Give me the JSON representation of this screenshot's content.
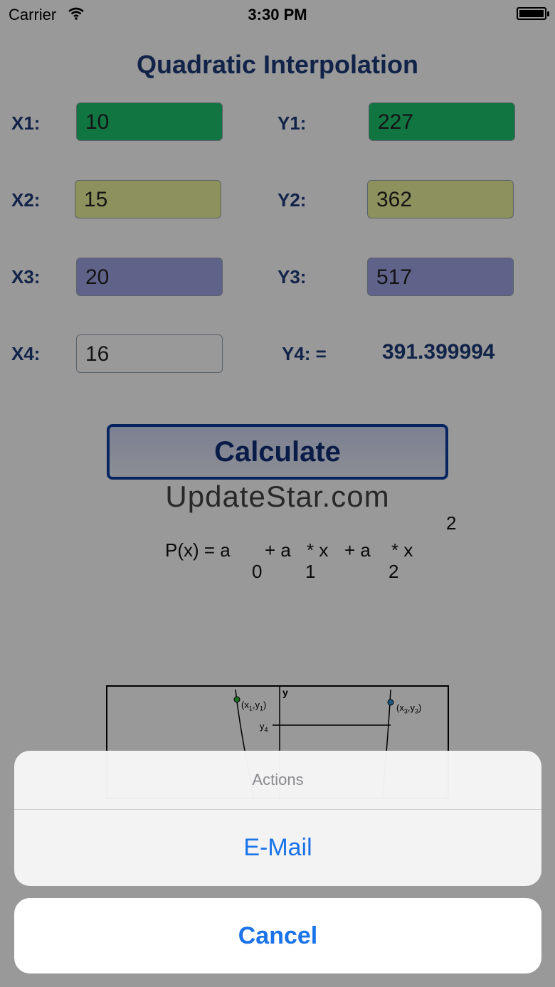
{
  "status_bar": {
    "carrier": "Carrier",
    "time": "3:30 PM"
  },
  "app": {
    "title": "Quadratic Interpolation",
    "fields": {
      "x1": {
        "label": "X1:",
        "value": "10"
      },
      "y1": {
        "label": "Y1:",
        "value": "227"
      },
      "x2": {
        "label": "X2:",
        "value": "15"
      },
      "y2": {
        "label": "Y2:",
        "value": "362"
      },
      "x3": {
        "label": "X3:",
        "value": "20"
      },
      "y3": {
        "label": "Y3:",
        "value": "517"
      },
      "x4": {
        "label": "X4:",
        "value": "16"
      }
    },
    "y4": {
      "label": "Y4: =",
      "value": "391.399994"
    },
    "calculate_label": "Calculate",
    "watermark": "UpdateStar.com",
    "formula": {
      "base": "P(x) = a",
      "t1": "+ a",
      "t2": "* x",
      "t3": "+ a",
      "t4": "* x",
      "sub0": "0",
      "sub1": "1",
      "sub2": "2",
      "exp": "2"
    },
    "diagram": {
      "y_axis": "y",
      "y4": "y",
      "y4_sub": "4",
      "p1": "(x",
      "p1b": ",y",
      "p1s": "1",
      "p3": "(x",
      "p3b": ",y",
      "p3s": "3"
    }
  },
  "action_sheet": {
    "title": "Actions",
    "option": "E-Mail",
    "cancel": "Cancel"
  },
  "colors": {
    "accent": "#1a73e8",
    "navy": "#1f3b7a",
    "field_green": "#1dc46e",
    "field_yellow": "#e9f29b",
    "field_purple": "#9ea5e6"
  }
}
